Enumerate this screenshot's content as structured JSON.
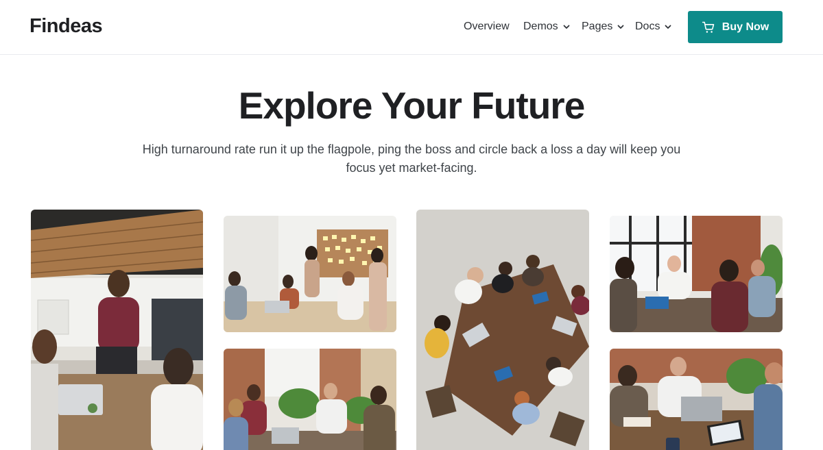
{
  "brand": {
    "name": "Findeas"
  },
  "nav": {
    "items": [
      {
        "label": "Overview",
        "dropdown": false
      },
      {
        "label": "Demos",
        "dropdown": true
      },
      {
        "label": "Pages",
        "dropdown": true
      },
      {
        "label": "Docs",
        "dropdown": true
      }
    ],
    "cta": {
      "label": "Buy Now",
      "icon": "cart-icon",
      "color": "#0d8b8a"
    }
  },
  "hero": {
    "title": "Explore Your Future",
    "subtitle": "High turnaround rate run it up the flagpole, ping the boss and circle back a loss a day will keep you focus yet market-facing."
  },
  "gallery": {
    "images": [
      {
        "subject": "man presenting with tablet in office"
      },
      {
        "subject": "team meeting near cork board with sticky notes"
      },
      {
        "subject": "group meeting in brick-walled office"
      },
      {
        "subject": "overhead view of team handshake at table"
      },
      {
        "subject": "team discussion at table with tablet"
      },
      {
        "subject": "colleagues with laptop and tablet"
      }
    ]
  },
  "colors": {
    "accent": "#0d8b8a",
    "text": "#1f2023",
    "muted": "#3f4449"
  }
}
